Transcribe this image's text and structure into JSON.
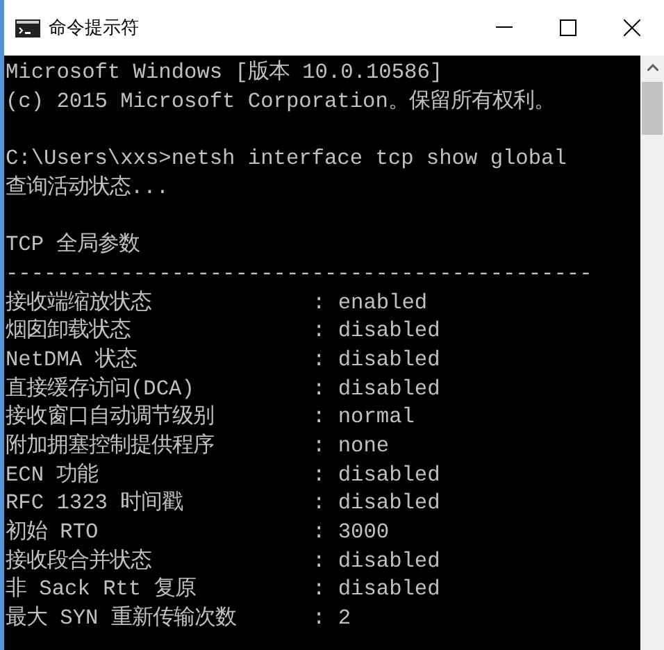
{
  "window": {
    "title": "命令提示符"
  },
  "console": {
    "lines": [
      {
        "kind": "text",
        "text": "Microsoft Windows [版本 10.0.10586]"
      },
      {
        "kind": "text",
        "text": "(c) 2015 Microsoft Corporation。保留所有权利。"
      },
      {
        "kind": "blank"
      },
      {
        "kind": "text",
        "text": "C:\\Users\\xxs>netsh interface tcp show global"
      },
      {
        "kind": "text",
        "text": "查询活动状态..."
      },
      {
        "kind": "blank"
      },
      {
        "kind": "text",
        "text": "TCP 全局参数"
      },
      {
        "kind": "text",
        "text": "----------------------------------------------"
      },
      {
        "kind": "param",
        "label": "接收端缩放状态",
        "value": ": enabled"
      },
      {
        "kind": "param",
        "label": "烟囱卸载状态",
        "value": ": disabled"
      },
      {
        "kind": "param",
        "label": "NetDMA 状态",
        "value": ": disabled"
      },
      {
        "kind": "param",
        "label": "直接缓存访问(DCA)",
        "value": ": disabled"
      },
      {
        "kind": "param",
        "label": "接收窗口自动调节级别",
        "value": ": normal"
      },
      {
        "kind": "param",
        "label": "附加拥塞控制提供程序",
        "value": ": none"
      },
      {
        "kind": "param",
        "label": "ECN 功能",
        "value": ": disabled"
      },
      {
        "kind": "param",
        "label": "RFC 1323 时间戳",
        "value": ": disabled"
      },
      {
        "kind": "param",
        "label": "初始 RTO",
        "value": ": 3000"
      },
      {
        "kind": "param",
        "label": "接收段合并状态",
        "value": ": disabled"
      },
      {
        "kind": "param",
        "label": "非 Sack Rtt 复原",
        "value": ": disabled"
      },
      {
        "kind": "param",
        "label": "最大 SYN 重新传输次数",
        "value": ": 2"
      }
    ]
  }
}
